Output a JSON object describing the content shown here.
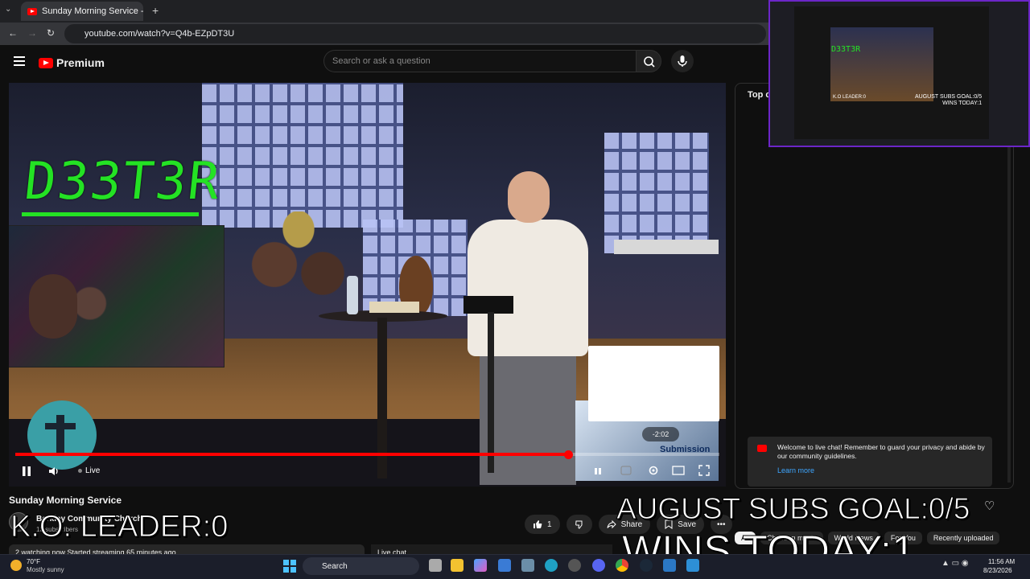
{
  "browser": {
    "tab_title": "Sunday Morning Service - Y",
    "url": "youtube.com/watch?v=Q4b-EZpDT3U"
  },
  "youtube": {
    "logo_text": "Premium",
    "search_placeholder": "Search or ask a question"
  },
  "player": {
    "overlay_name": "D33T3R",
    "live_label": "Live",
    "countdown": "-2:02",
    "endcard_label": "Submission",
    "progress_fraction": 0.785
  },
  "video": {
    "title": "Sunday Morning Service",
    "channel": "Berkley Community Church",
    "subs": "13 subscribers",
    "likes": "1",
    "share_label": "Share",
    "save_label": "Save",
    "watching": "2 watching now  Started streaming 65 minutes ago",
    "live_chat_label": "Live chat"
  },
  "chat": {
    "header": "Top c",
    "welcome": "Welcome to live chat! Remember to guard your privacy and abide by our community guidelines.",
    "learn_more": "Learn more",
    "chips": [
      "All",
      "Christian music",
      "World News",
      "For You",
      "Recently uploaded"
    ]
  },
  "stream_overlay": {
    "ko_leader": "K.O. LEADER:0",
    "subs_goal": "AUGUST SUBS GOAL:0/5",
    "wins_today": "WINS TODAY:1"
  },
  "obs_preview": {
    "mini_name": "D33T3R",
    "mini_goal": "AUGUST SUBS GOAL:0/5",
    "mini_wins": "WINS TODAY:1",
    "mini_leader": "K.O LEADER:0"
  },
  "taskbar": {
    "temp": "70°F",
    "weather": "Mostly sunny",
    "search": "Search",
    "time": "11:56 AM",
    "date": "8/23/2026"
  },
  "colors": {
    "accent": "#ff0000",
    "overlay_green": "#24e224",
    "link": "#3ea6ff"
  }
}
